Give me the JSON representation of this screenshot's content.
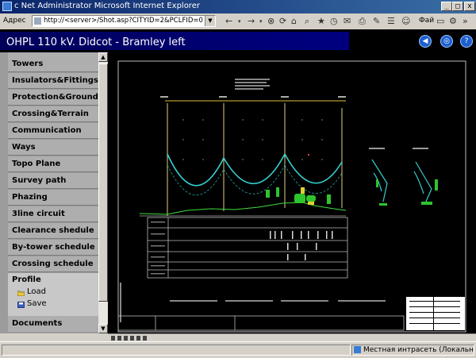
{
  "window": {
    "title": "c Net   Administrator   Microsoft Internet Explorer",
    "buttons": [
      "_",
      "□",
      "x"
    ]
  },
  "address_bar": {
    "label": "Адрес",
    "url": "http://<server>/Shot.asp?CITYID=2&PCLFID=0"
  },
  "language_label": "Фай",
  "header": {
    "title": "OHPL 110 kV. Didcot - Bramley left",
    "icons": [
      "back-icon",
      "globe-icon",
      "help-icon"
    ]
  },
  "sidebar": {
    "items": [
      {
        "label": "Towers"
      },
      {
        "label": "Insulators&Fittings"
      },
      {
        "label": "Protection&Grounding"
      },
      {
        "label": "Crossing&Terrain"
      },
      {
        "label": "Communication"
      },
      {
        "label": "Ways"
      },
      {
        "label": "Topo Plane"
      },
      {
        "label": "Survey path"
      },
      {
        "label": "Phazing"
      },
      {
        "label": "3line circuit"
      },
      {
        "label": "Clearance shedule"
      },
      {
        "label": "By-tower schedule"
      },
      {
        "label": "Crossing schedule"
      }
    ],
    "profile": {
      "label": "Profile",
      "sub_items": [
        {
          "label": "Load",
          "icon": "folder-open-icon"
        },
        {
          "label": "Save",
          "icon": "save-icon"
        }
      ]
    },
    "documents_label": "Documents"
  },
  "status_bar": {
    "zone_text": "Местная интрасеть (Локальн"
  },
  "colors": {
    "title_bar_start": "#0a246a",
    "title_bar_end": "#3a6ea5",
    "header_bg": "#000080",
    "sidebar_item": "#aeaeae",
    "drawing_bg": "#000000",
    "conductor": "#35d0d0",
    "ground_line": "#3fdc3f"
  }
}
